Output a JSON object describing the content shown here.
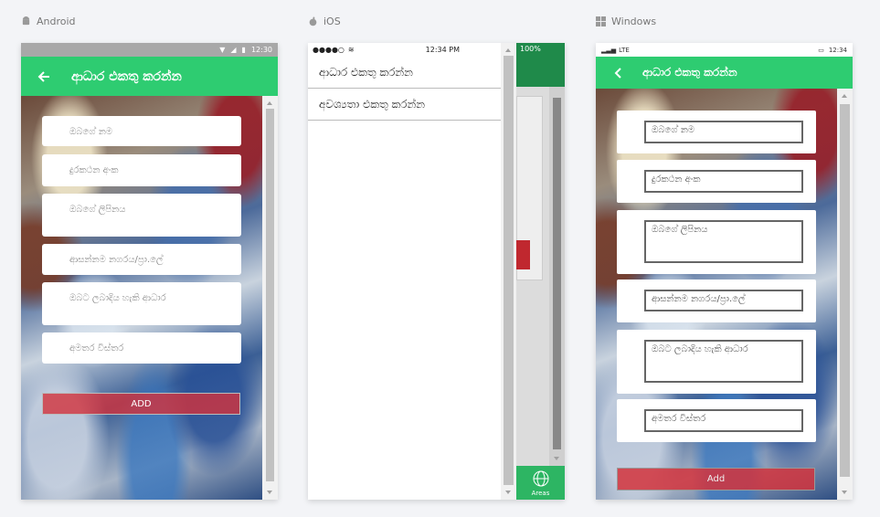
{
  "platforms": {
    "android": "Android",
    "ios": "iOS",
    "windows": "Windows"
  },
  "android": {
    "time": "12:30",
    "title": "ආධාර එකතු කරන්න",
    "fields": [
      "ඔබගේ නම",
      "දුරකථන අංක",
      "ඔබගේ ලිපිනය",
      "ආසන්නම නගරය/ප්‍රා.ලේ",
      "ඔබට ලබාදිය හැකි ආධාර",
      "අමතර විස්තර"
    ],
    "add_label": "ADD"
  },
  "ios": {
    "time": "12:34 PM",
    "battery": "100%",
    "menu": [
      "ආධාර එකතු කරන්න",
      "අවශ්‍යතා එකතු කරන්න"
    ],
    "tab_label": "Areas"
  },
  "windows": {
    "network": "LTE",
    "time": "12:34",
    "title": "ආධාර එකතු කරන්න",
    "fields": [
      "ඔබගේ නම",
      "දුරකථන අංක",
      "ඔබගේ ලිපිනය",
      "ආසන්නම නගරය/ප්‍රා.ලේ",
      "ඔබට ලබාදිය හැකි ආධාර",
      "අමතර විස්තර"
    ],
    "add_label": "Add"
  },
  "colors": {
    "accent": "#2ecc71",
    "add_button": "#d2323c",
    "ios_side": "#1f8a4a"
  }
}
